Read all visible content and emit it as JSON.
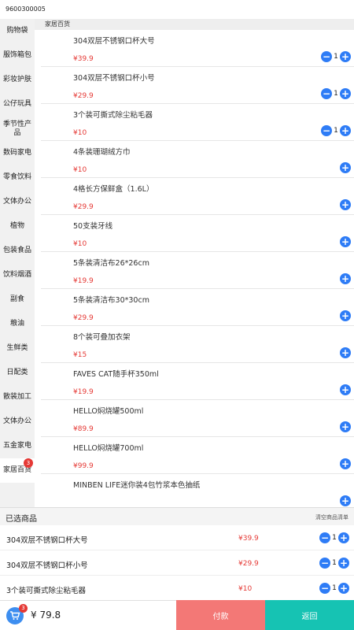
{
  "top": {
    "code": "9600300005"
  },
  "sidebar": {
    "items": [
      {
        "label": "购物袋"
      },
      {
        "label": "服饰箱包"
      },
      {
        "label": "彩妆护肤"
      },
      {
        "label": "公仔玩具"
      },
      {
        "label": "季节性产品"
      },
      {
        "label": "数码家电"
      },
      {
        "label": "零食饮料"
      },
      {
        "label": "文体办公"
      },
      {
        "label": "植物"
      },
      {
        "label": "包装食品"
      },
      {
        "label": "饮料烟酒"
      },
      {
        "label": "副食"
      },
      {
        "label": "粮油"
      },
      {
        "label": "生鲜类"
      },
      {
        "label": "日配类"
      },
      {
        "label": "散装加工"
      },
      {
        "label": "文体办公"
      },
      {
        "label": "五金家电"
      },
      {
        "label": "家居百货"
      }
    ],
    "active_badge": "3"
  },
  "content": {
    "category_title": "家居百货",
    "products": [
      {
        "name": "304双层不锈钢口杯大号",
        "price": "¥39.9",
        "qty": "1"
      },
      {
        "name": "304双层不锈钢口杯小号",
        "price": "¥29.9",
        "qty": "1"
      },
      {
        "name": "3个装可撕式除尘粘毛器",
        "price": "¥10",
        "qty": "1"
      },
      {
        "name": "4条装珊瑚绒方巾",
        "price": "¥10",
        "qty": ""
      },
      {
        "name": "4格长方保鲜盒（1.6L）",
        "price": "¥29.9",
        "qty": ""
      },
      {
        "name": "50支装牙线",
        "price": "¥10",
        "qty": ""
      },
      {
        "name": "5条装清洁布26*26cm",
        "price": "¥19.9",
        "qty": ""
      },
      {
        "name": "5条装清洁布30*30cm",
        "price": "¥29.9",
        "qty": ""
      },
      {
        "name": "8个装可叠加衣架",
        "price": "¥15",
        "qty": ""
      },
      {
        "name": "FAVES CAT随手杯350ml",
        "price": "¥19.9",
        "qty": ""
      },
      {
        "name": "HELLO焖烧罐500ml",
        "price": "¥89.9",
        "qty": ""
      },
      {
        "name": "HELLO焖烧罐700ml",
        "price": "¥99.9",
        "qty": ""
      },
      {
        "name": "MINBEN LIFE迷你装4包竹浆本色抽纸",
        "price": "",
        "qty": ""
      }
    ]
  },
  "selected": {
    "title": "已选商品",
    "clear_label": "清空商品清单",
    "items": [
      {
        "name": "304双层不锈钢口杯大号",
        "price": "¥39.9",
        "qty": "1"
      },
      {
        "name": "304双层不锈钢口杯小号",
        "price": "¥29.9",
        "qty": "1"
      },
      {
        "name": "3个装可撕式除尘粘毛器",
        "price": "¥10",
        "qty": "1"
      }
    ]
  },
  "bottom": {
    "cart_badge": "3",
    "total": "¥ 79.8",
    "pay_label": "付款",
    "back_label": "返回"
  },
  "colors": {
    "accent_blue": "#2e7cf6",
    "price_red": "#e53935",
    "pay": "#f37876",
    "back": "#16c3b3"
  },
  "icons": {
    "minus": "minus-icon",
    "plus": "plus-icon",
    "cart": "cart-icon"
  }
}
